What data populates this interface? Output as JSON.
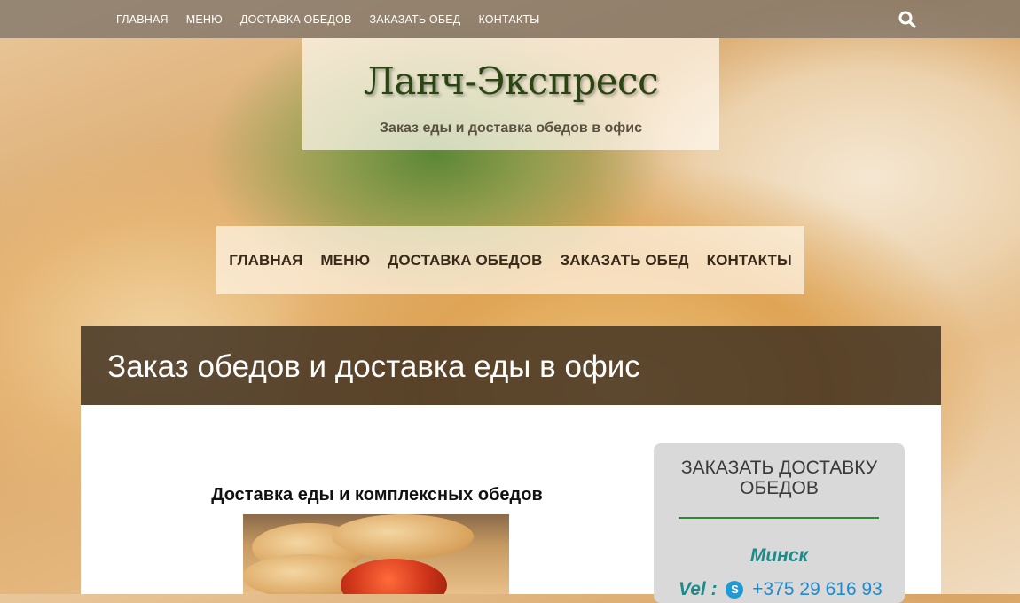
{
  "top_nav": {
    "items": [
      "ГЛАВНАЯ",
      "МЕНЮ",
      "ДОСТАВКА ОБЕДОВ",
      "ЗАКАЗАТЬ ОБЕД",
      "КОНТАКТЫ"
    ],
    "search_icon": "search-icon"
  },
  "brand": {
    "title": "Ланч-Экспресс",
    "subtitle": "Заказ еды и доставка обедов в офис"
  },
  "main_nav": {
    "items": [
      "ГЛАВНАЯ",
      "МЕНЮ",
      "ДОСТАВКА ОБЕДОВ",
      "ЗАКАЗАТЬ ОБЕД",
      "КОНТАКТЫ"
    ]
  },
  "page": {
    "heading": "Заказ обедов и доставка еды в офис"
  },
  "article": {
    "title": "Доставка еды и комплексных обедов"
  },
  "widget": {
    "title": "ЗАКАЗАТЬ ДОСТАВКУ ОБЕДОВ",
    "city": "Минск",
    "phone_label": "Vel :",
    "phone_number": "+375 29 616 93",
    "skype_icon": "skype-icon"
  },
  "colors": {
    "topbar": "#7d7369",
    "page_head": "#3c2d1e",
    "widget_bg": "#d9d9d9",
    "widget_line": "#2f8a2f",
    "city": "#1f8a8a",
    "phone": "#1f8ad0"
  }
}
